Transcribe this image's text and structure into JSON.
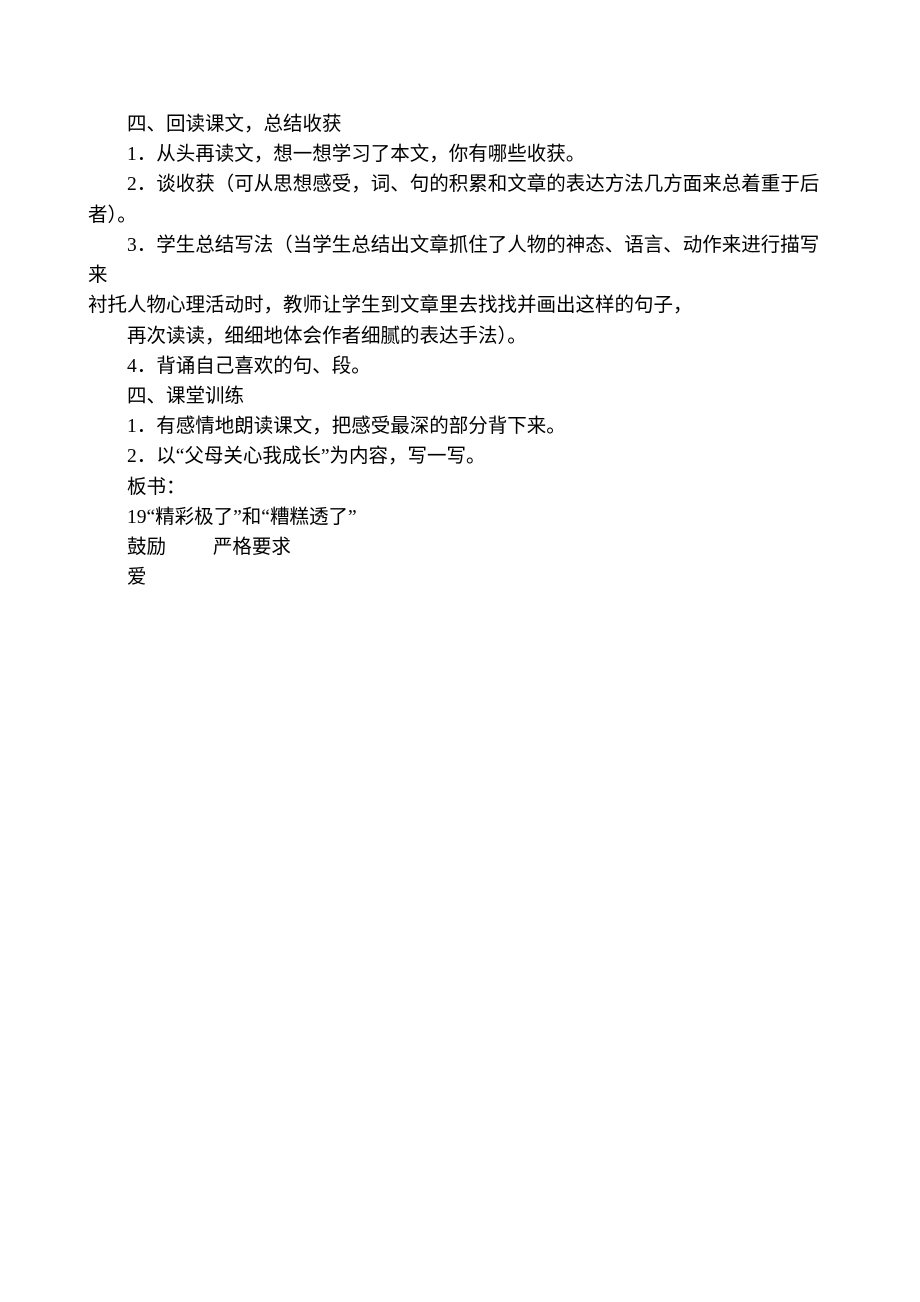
{
  "lines": {
    "l1": "四、回读课文，总结收获",
    "l2": "1．从头再读文，想一想学习了本文，你有哪些收获。",
    "l3a": "2．谈收获（可从思想感受，词、句的积累和文章的表达方法几方面来总着重于后",
    "l3b": "者）。",
    "l4a": "3．学生总结写法（当学生总结出文章抓住了人物的神态、语言、动作来进行描写来",
    "l4b": "衬托人物心理活动时，教师让学生到文章里去找找并画出这样的句子，",
    "l5": "再次读读，细细地体会作者细腻的表达手法）。",
    "l6": "4．背诵自己喜欢的句、段。",
    "l7": "四、课堂训练",
    "l8": "1．有感情地朗读课文，把感受最深的部分背下来。",
    "l9": "2．以“父母关心我成长”为内容，写一写。",
    "l10": "板书：",
    "l11": "19“精彩极了”和“糟糕透了”",
    "l12a": "鼓励",
    "l12b": "严格要求",
    "l13": "爱"
  }
}
